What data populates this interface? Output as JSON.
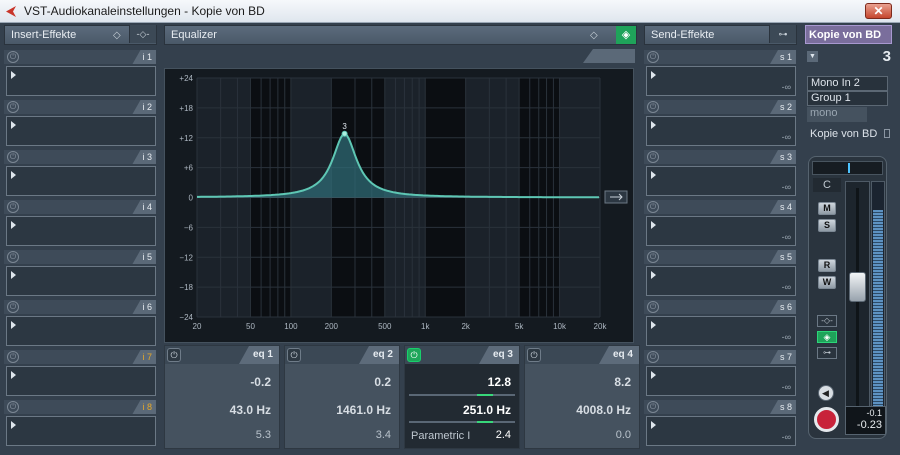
{
  "window": {
    "title": "VST-Audiokanaleinstellungen - Kopie von BD",
    "close_label": "✕"
  },
  "inserts": {
    "header": "Insert-Effekte",
    "slots": [
      {
        "label": "i 1",
        "highlight": false
      },
      {
        "label": "i 2",
        "highlight": false
      },
      {
        "label": "i 3",
        "highlight": false
      },
      {
        "label": "i 4",
        "highlight": false
      },
      {
        "label": "i 5",
        "highlight": false
      },
      {
        "label": "i 6",
        "highlight": false
      },
      {
        "label": "i 7",
        "highlight": true
      },
      {
        "label": "i 8",
        "highlight": true
      }
    ]
  },
  "equalizer": {
    "header": "Equalizer",
    "y_ticks": [
      "+24",
      "+18",
      "+12",
      "+6",
      "0",
      "−6",
      "−12",
      "−18",
      "−24"
    ],
    "x_ticks": [
      "20",
      "50",
      "100",
      "200",
      "500",
      "1k",
      "2k",
      "5k",
      "10k",
      "20k"
    ],
    "curve": {
      "peak_freq_hz": 251,
      "peak_gain_db": 12.8,
      "q": 2.4,
      "marker_label": "3"
    },
    "bands": [
      {
        "name": "eq 1",
        "gain": "-0.2",
        "freq": "43.0 Hz",
        "q": "5.3",
        "active": false,
        "type": ""
      },
      {
        "name": "eq 2",
        "gain": "0.2",
        "freq": "1461.0 Hz",
        "q": "3.4",
        "active": false,
        "type": ""
      },
      {
        "name": "eq 3",
        "gain": "12.8",
        "freq": "251.0 Hz",
        "q": "2.4",
        "active": true,
        "type": "Parametric I"
      },
      {
        "name": "eq 4",
        "gain": "8.2",
        "freq": "4008.0 Hz",
        "q": "0.0",
        "active": false,
        "type": ""
      }
    ]
  },
  "sends": {
    "header": "Send-Effekte",
    "slots": [
      {
        "label": "s 1",
        "value": "-∞"
      },
      {
        "label": "s 2",
        "value": "-∞"
      },
      {
        "label": "s 3",
        "value": "-∞"
      },
      {
        "label": "s 4",
        "value": "-∞"
      },
      {
        "label": "s 5",
        "value": "-∞"
      },
      {
        "label": "s 6",
        "value": "-∞"
      },
      {
        "label": "s 7",
        "value": "-∞"
      },
      {
        "label": "s 8",
        "value": "-∞"
      }
    ]
  },
  "channel": {
    "name": "Kopie von BD",
    "number": "3",
    "input": "Mono In 2",
    "output": "Group 1",
    "mode": "mono",
    "routing_name": "Kopie von BD",
    "pan": "C",
    "buttons": {
      "mute": "M",
      "solo": "S",
      "read": "R",
      "write": "W"
    },
    "fader_level": 0.58,
    "meter_level": 0.88,
    "peak": "-0.1",
    "volume": "-0.23"
  }
}
